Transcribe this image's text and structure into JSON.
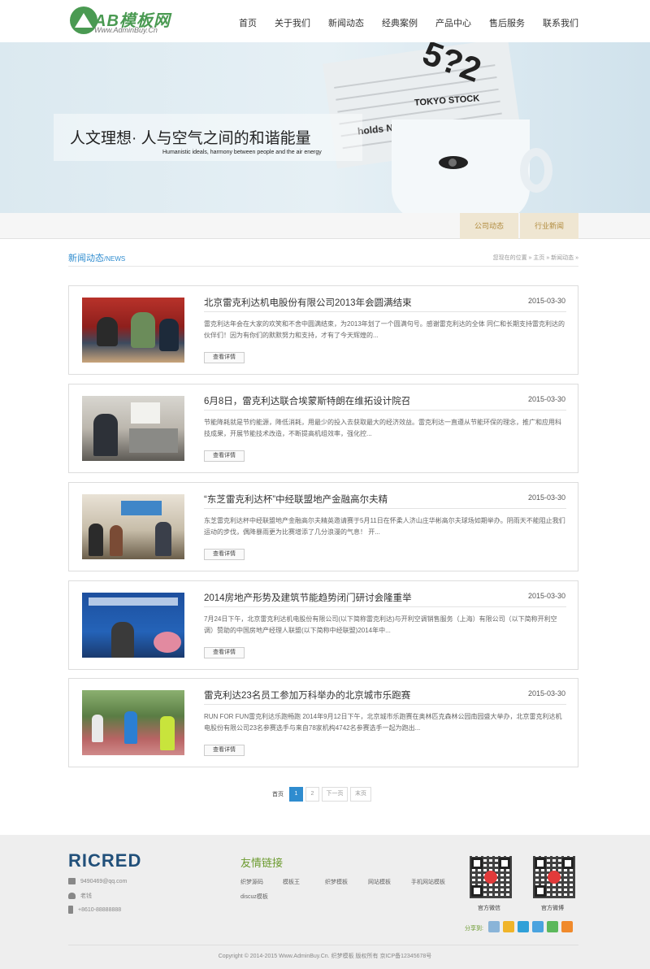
{
  "header": {
    "logo_text": "AB模板网",
    "logo_sub": "Www.AdminBuy.Cn",
    "nav": [
      "首页",
      "关于我们",
      "新闻动态",
      "经典案例",
      "产品中心",
      "售后服务",
      "联系我们"
    ]
  },
  "banner": {
    "title": "人文理想· 人与空气之间的和谐能量",
    "subtitle": "Humanistic ideals, harmony between people and the air energy",
    "paper_tag": "TOKYO STOCK",
    "paper_head": "holds Na"
  },
  "subnav": {
    "tabs": [
      "公司动态",
      "行业新闻"
    ]
  },
  "section": {
    "title": "新闻动态",
    "title_en": "/NEWS",
    "breadcrumb": "您现在的位置 » 主页 » 新闻动态 »"
  },
  "news": [
    {
      "title": "北京雷克利达机电股份有限公司2013年会圆满结束",
      "date": "2015-03-30",
      "summary": "雷克利达年会在大家的欢笑和不舍中圆满结束，为2013年划了一个圆满句号。感谢雷克利达的全体 同仁和长期支持雷克利达的伙伴们！因为有你们的默默努力和支持，才有了今天辉煌的...",
      "more": "查看详情"
    },
    {
      "title": "6月8日，雷克利达联合埃蒙斯特朗在维拓设计院召",
      "date": "2015-03-30",
      "summary": "节能降耗就是节约能源，降低消耗，用最少的投入去获取最大的经济效益。雷克利达一直遵从节能环保的理念，推广和应用科技成果，开展节能技术改造，不断提高机组效率，强化控...",
      "more": "查看详情"
    },
    {
      "title": "“东芝雷克利达杯”中经联盟地产金融高尔夫精",
      "date": "2015-03-30",
      "summary": "东芝雷克利达杯中经联盟地产金融高尔夫精英邀请赛于5月11日在怀柔人济山庄华彬高尔夫球场如期举办。阴雨天不能阻止我们运动的步伐，偶降暴雨更为比赛增添了几分浪漫的气息！ 开...",
      "more": "查看详情"
    },
    {
      "title": "2014房地产形势及建筑节能趋势闭门研讨会隆重举",
      "date": "2015-03-30",
      "summary": "7月24日下午，北京雷克利达机电股份有限公司(以下简称雷克利达)与开利空调销售服务（上海）有限公司（以下简称开利空调）赞助的中国房地产经理人联盟(以下简称中经联盟)2014年中...",
      "more": "查看详情"
    },
    {
      "title": "雷克利达23名员工参加万科举办的北京城市乐跑赛",
      "date": "2015-03-30",
      "summary": "RUN FOR FUN雷克利达乐跑畅跑 2014年9月12日下午，北京城市乐跑赛在奥林匹克森林公园南园盛大举办，北京雷克利达机电股份有限公司23名参赛选手与来自78家机构4742名参赛选手一起为跑出...",
      "more": "查看详情"
    }
  ],
  "pagination": {
    "label": "首页",
    "pages": [
      "1",
      "2"
    ],
    "next": "下一页",
    "last": "末页",
    "current": "1"
  },
  "footer": {
    "logo": "RICRED",
    "email": "9490469@qq.com",
    "person": "老钱",
    "phone": "+8610-88888888",
    "links_title": "友情链接",
    "links": [
      "织梦源码",
      "模板王",
      "织梦模板",
      "网站模板",
      "手机网站模板",
      "discuz模板"
    ],
    "qr_captions": [
      "官方微信",
      "官方微博"
    ],
    "share_label": "分享到:",
    "copyright": "Copyright © 2014-2015 Www.AdminBuy.Cn. 织梦模板 版权所有  京ICP备12345678号"
  },
  "colors": {
    "accent": "#2f8ccf",
    "logo_green": "#4a9a52",
    "tab_bg": "#efe6d2",
    "tab_text": "#b08a3c",
    "footer_bg": "#eeeeee"
  }
}
